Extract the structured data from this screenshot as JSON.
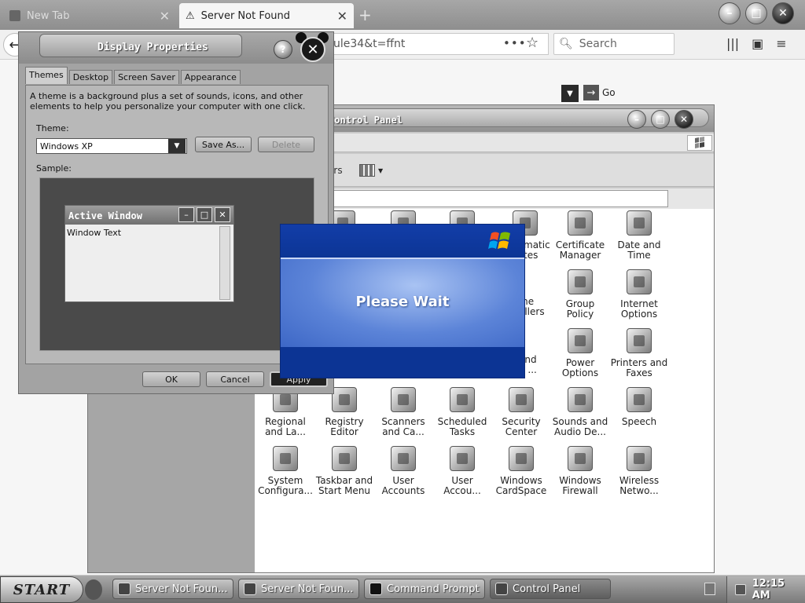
{
  "browser": {
    "tabs": [
      {
        "label": "New Tab"
      },
      {
        "label": "Server Not Found"
      }
    ],
    "url_fragment": "ule34&t=ffnt",
    "search": {
      "placeholder": "Search"
    }
  },
  "control_panel": {
    "title": "Control Panel",
    "toolbar_text": "ers",
    "go_label": "Go",
    "items": [
      {
        "label": "Certificate\nManager",
        "icon": "certificate-icon"
      },
      {
        "label": "Date and\nTime",
        "icon": "clock-icon"
      },
      {
        "label": "Group\nPolicy",
        "icon": "group-policy-icon"
      },
      {
        "label": "Internet\nOptions",
        "icon": "globe-icon"
      },
      {
        "label": "Power\nOptions",
        "icon": "power-icon"
      },
      {
        "label": "Printers and\nFaxes",
        "icon": "printer-icon"
      },
      {
        "label": "Regional\nand La...",
        "icon": "regional-icon"
      },
      {
        "label": "Registry\nEditor",
        "icon": "registry-icon"
      },
      {
        "label": "Scanners\nand Ca...",
        "icon": "scanner-icon"
      },
      {
        "label": "Scheduled\nTasks",
        "icon": "scheduled-tasks-icon"
      },
      {
        "label": "Security\nCenter",
        "icon": "shield-icon"
      },
      {
        "label": "Sounds and\nAudio De...",
        "icon": "speaker-icon"
      },
      {
        "label": "Speech",
        "icon": "speech-icon"
      },
      {
        "label": "System\nConfigura...",
        "icon": "system-config-icon"
      },
      {
        "label": "Taskbar and\nStart Menu",
        "icon": "taskbar-icon"
      },
      {
        "label": "User\nAccounts",
        "icon": "users-icon"
      },
      {
        "label": "User\nAccou...",
        "icon": "user-account-icon"
      },
      {
        "label": "Windows\nCardSpace",
        "icon": "cardspace-icon"
      },
      {
        "label": "Windows\nFirewall",
        "icon": "firewall-icon"
      },
      {
        "label": "Wireless\nNetwo...",
        "icon": "wireless-icon"
      }
    ],
    "partial_labels": [
      {
        "label": "matic\ntes"
      },
      {
        "label": "me\nollers"
      },
      {
        "label": "and\nn ..."
      }
    ]
  },
  "display_properties": {
    "title": "Display Properties",
    "help_label": "?",
    "tabs": [
      {
        "label": "Themes"
      },
      {
        "label": "Desktop"
      },
      {
        "label": "Screen Saver"
      },
      {
        "label": "Appearance"
      }
    ],
    "description": "A theme is a background plus a set of sounds, icons, and other elements to help you personalize your computer with one click.",
    "theme_label": "Theme:",
    "theme_value": "Windows XP",
    "save_as_label": "Save As...",
    "delete_label": "Delete",
    "sample_label": "Sample:",
    "sample_window_title": "Active Window",
    "sample_window_text": "Window Text",
    "ok_label": "OK",
    "cancel_label": "Cancel",
    "apply_label": "Apply"
  },
  "please_wait": {
    "text": "Please Wait"
  },
  "taskbar": {
    "start_label": "START",
    "items": [
      {
        "label": "Server Not Foun..."
      },
      {
        "label": "Server Not Foun..."
      },
      {
        "label": "Command Prompt"
      },
      {
        "label": "Control Panel"
      }
    ],
    "clock": "12:15 AM"
  }
}
